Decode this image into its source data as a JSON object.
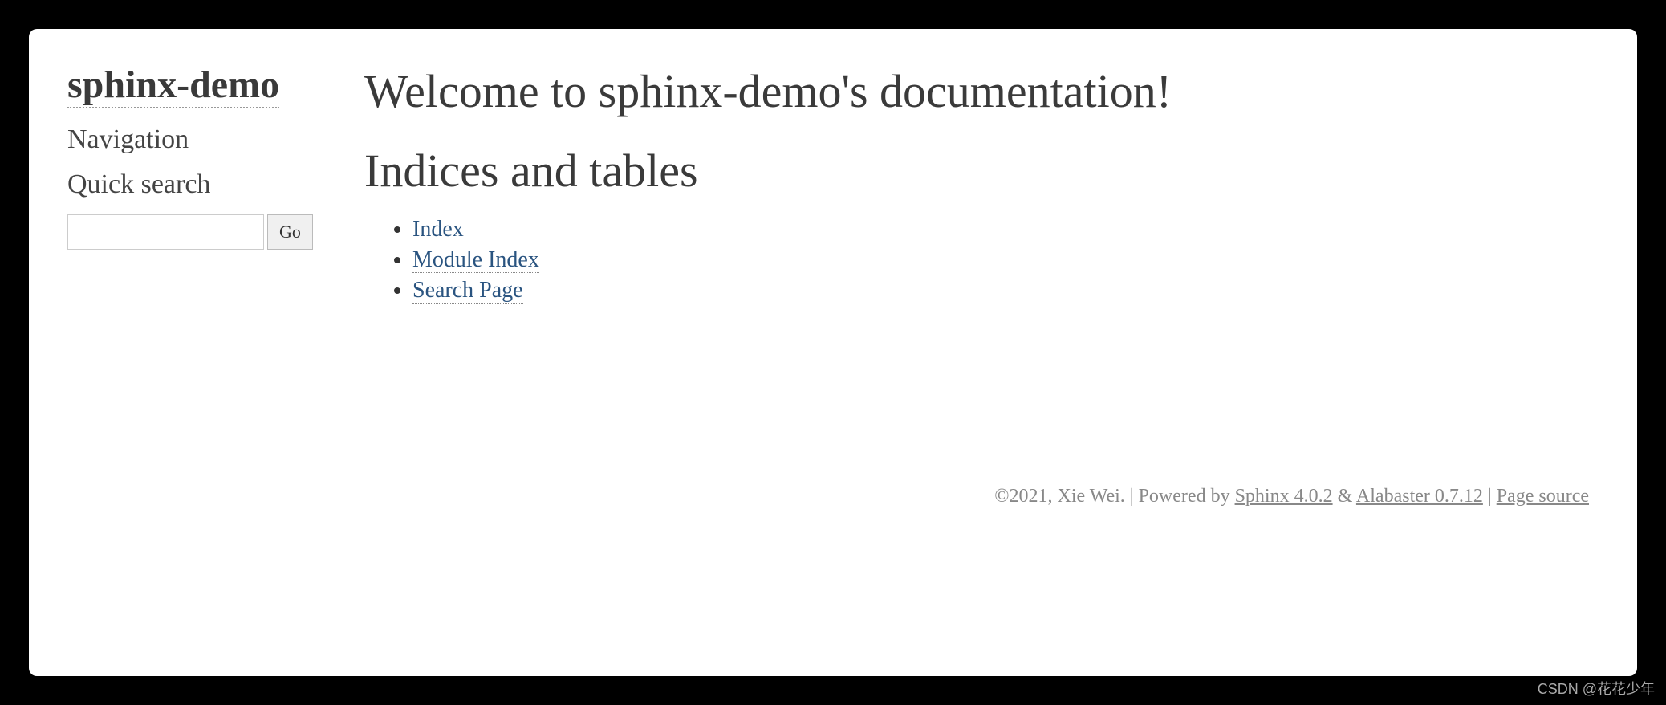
{
  "sidebar": {
    "title": "sphinx-demo",
    "navigation_label": "Navigation",
    "search_label": "Quick search",
    "search_button": "Go"
  },
  "main": {
    "heading": "Welcome to sphinx-demo's documentation!",
    "subheading": "Indices and tables",
    "links": {
      "index": "Index",
      "module_index": "Module Index",
      "search_page": "Search Page"
    }
  },
  "footer": {
    "copyright": "©2021, Xie Wei. ",
    "powered_by_prefix": "| Powered by ",
    "sphinx_link": "Sphinx 4.0.2",
    "amp": " & ",
    "alabaster_link": "Alabaster 0.7.12",
    "sep": " | ",
    "page_source": "Page source"
  },
  "watermark": "CSDN @花花少年"
}
